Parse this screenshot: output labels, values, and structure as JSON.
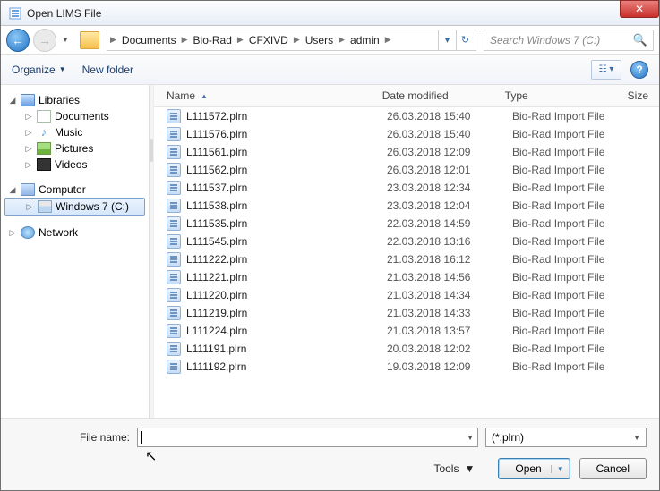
{
  "title": "Open LIMS File",
  "breadcrumb": [
    "Documents",
    "Bio-Rad",
    "CFXIVD",
    "Users",
    "admin"
  ],
  "search_placeholder": "Search Windows 7 (C:)",
  "toolbar": {
    "organize": "Organize",
    "new_folder": "New folder"
  },
  "columns": {
    "name": "Name",
    "date": "Date modified",
    "type": "Type",
    "size": "Size"
  },
  "tree": {
    "libraries": {
      "label": "Libraries",
      "children": {
        "documents": "Documents",
        "music": "Music",
        "pictures": "Pictures",
        "videos": "Videos"
      }
    },
    "computer": {
      "label": "Computer",
      "children": {
        "c_drive": "Windows 7 (C:)"
      }
    },
    "network": {
      "label": "Network"
    }
  },
  "files": [
    {
      "name": "L111572.plrn",
      "date": "26.03.2018 15:40",
      "type": "Bio-Rad Import File"
    },
    {
      "name": "L111576.plrn",
      "date": "26.03.2018 15:40",
      "type": "Bio-Rad Import File"
    },
    {
      "name": "L111561.plrn",
      "date": "26.03.2018 12:09",
      "type": "Bio-Rad Import File"
    },
    {
      "name": "L111562.plrn",
      "date": "26.03.2018 12:01",
      "type": "Bio-Rad Import File"
    },
    {
      "name": "L111537.plrn",
      "date": "23.03.2018 12:34",
      "type": "Bio-Rad Import File"
    },
    {
      "name": "L111538.plrn",
      "date": "23.03.2018 12:04",
      "type": "Bio-Rad Import File"
    },
    {
      "name": "L111535.plrn",
      "date": "22.03.2018 14:59",
      "type": "Bio-Rad Import File"
    },
    {
      "name": "L111545.plrn",
      "date": "22.03.2018 13:16",
      "type": "Bio-Rad Import File"
    },
    {
      "name": "L111222.plrn",
      "date": "21.03.2018 16:12",
      "type": "Bio-Rad Import File"
    },
    {
      "name": "L111221.plrn",
      "date": "21.03.2018 14:56",
      "type": "Bio-Rad Import File"
    },
    {
      "name": "L111220.plrn",
      "date": "21.03.2018 14:34",
      "type": "Bio-Rad Import File"
    },
    {
      "name": "L111219.plrn",
      "date": "21.03.2018 14:33",
      "type": "Bio-Rad Import File"
    },
    {
      "name": "L111224.plrn",
      "date": "21.03.2018 13:57",
      "type": "Bio-Rad Import File"
    },
    {
      "name": "L111191.plrn",
      "date": "20.03.2018 12:02",
      "type": "Bio-Rad Import File"
    },
    {
      "name": "L111192.plrn",
      "date": "19.03.2018 12:09",
      "type": "Bio-Rad Import File"
    }
  ],
  "footer": {
    "file_name_label": "File name:",
    "filter": "(*.plrn)",
    "tools": "Tools",
    "open": "Open",
    "cancel": "Cancel"
  }
}
